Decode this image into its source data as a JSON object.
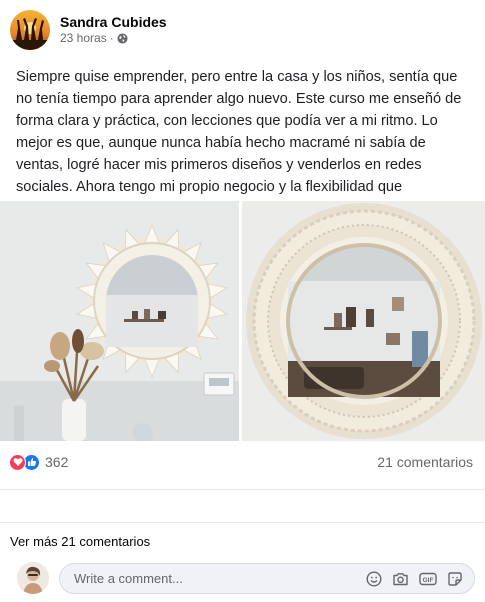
{
  "post": {
    "author": "Sandra Cubides",
    "time": "23 horas",
    "separator": "·",
    "privacy_icon": "globe-icon",
    "text": "Siempre quise emprender, pero entre la casa y los niños, sentía que no tenía tiempo para aprender algo nuevo. Este curso me enseñó de forma clara y práctica, con lecciones que podía ver a mi ritmo. Lo mejor es que, aunque nunca había hecho macramé ni sabía de ventas, logré hacer mis primeros diseños y venderlos en redes sociales. Ahora tengo mi propio negocio y la flexibilidad que necesitaba. Infinitas gracias!!",
    "photos": [
      "macrame-mirror-wall-photo",
      "macrame-mirror-closeup-photo"
    ]
  },
  "stats": {
    "reaction_icons": [
      "love-reaction-icon",
      "like-reaction-icon"
    ],
    "reaction_count": "362",
    "comments_count": "21 comentarios"
  },
  "comments": {
    "view_more": "Ver más 21 comentarios",
    "composer_placeholder": "Write a comment...",
    "tools": [
      "emoji-icon",
      "camera-icon",
      "gif-icon",
      "sticker-icon"
    ]
  },
  "colors": {
    "like_blue": "#1877f2",
    "love_red": "#f33e58",
    "secondary_text": "#65676b"
  }
}
